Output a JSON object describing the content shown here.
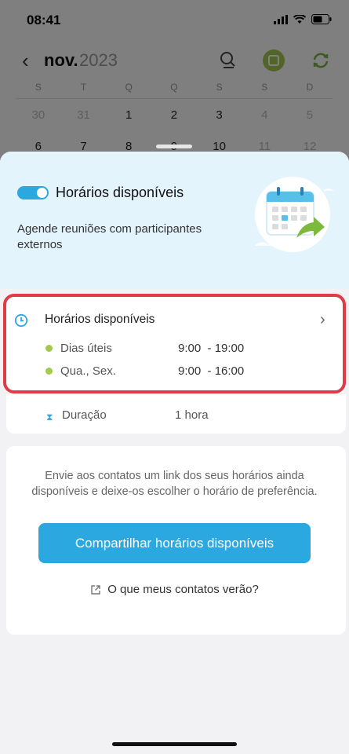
{
  "status_bar": {
    "time": "08:41"
  },
  "calendar": {
    "back_icon": "chevron-left-icon",
    "month": "nov.",
    "year": "2023",
    "weekdays": [
      "S",
      "T",
      "Q",
      "Q",
      "S",
      "S",
      "D"
    ],
    "week1": [
      "30",
      "31",
      "1",
      "2",
      "3",
      "4",
      "5"
    ],
    "week2": [
      "6",
      "7",
      "8",
      "9",
      "10",
      "11",
      "12"
    ]
  },
  "sheet": {
    "hero": {
      "toggle_on": true,
      "title": "Horários disponíveis",
      "subtitle": "Agende reuniões com participantes externos"
    },
    "hours": {
      "title": "Horários disponíveis",
      "rows": [
        {
          "label": "Dias úteis",
          "time": "9:00  - 19:00"
        },
        {
          "label": "Qua., Sex.",
          "time": "9:00  - 16:00"
        }
      ]
    },
    "duration": {
      "label": "Duração",
      "value": "1 hora"
    },
    "share": {
      "description": "Envie aos contatos um link dos seus horários ainda disponíveis e deixe-os escolher o horário de preferência.",
      "button_label": "Compartilhar horários disponíveis",
      "link_label": "O que meus contatos verão?"
    }
  },
  "colors": {
    "accent": "#2ba8e0",
    "highlight": "#e03b46",
    "check": "#a5c94f",
    "hero_bg": "#e4f4fc"
  }
}
